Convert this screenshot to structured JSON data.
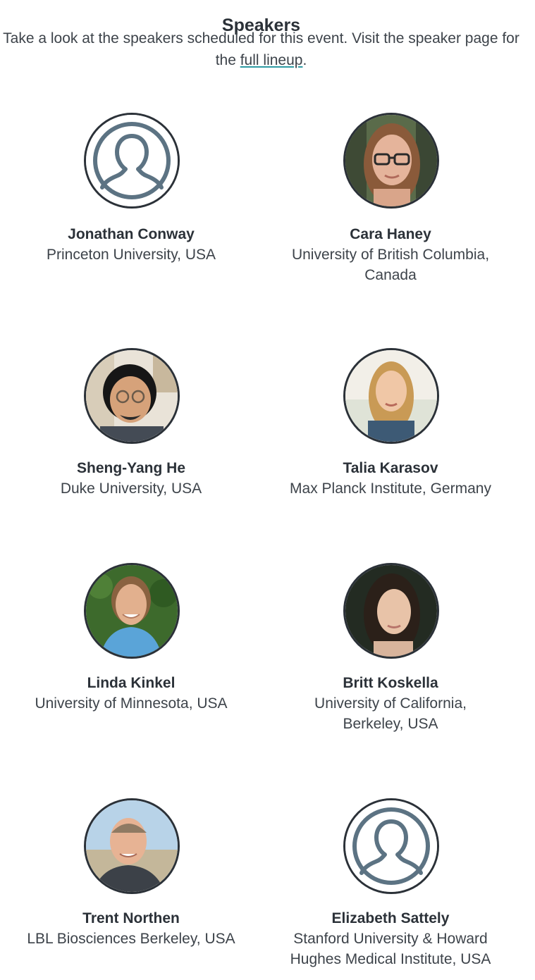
{
  "header": {
    "title": "Speakers",
    "intro_text": "Take a look at the speakers scheduled for this event. Visit the speaker page for the ",
    "link_label": "full lineup",
    "intro_end": "."
  },
  "speakers": [
    {
      "name": "Jonathan Conway",
      "affiliation": "Princeton University, USA",
      "photo": "placeholder-avatar-icon"
    },
    {
      "name": "Cara Haney",
      "affiliation": "University of British Columbia, Canada",
      "photo": "speaker-photo"
    },
    {
      "name": "Sheng-Yang He",
      "affiliation": "Duke University, USA",
      "photo": "speaker-photo"
    },
    {
      "name": "Talia Karasov",
      "affiliation": "Max Planck Institute, Germany",
      "photo": "speaker-photo"
    },
    {
      "name": "Linda Kinkel",
      "affiliation": "University of Minnesota, USA",
      "photo": "speaker-photo"
    },
    {
      "name": "Britt Koskella",
      "affiliation": "University of California, Berkeley, USA",
      "photo": "speaker-photo"
    },
    {
      "name": "Trent Northen",
      "affiliation": "LBL Biosciences Berkeley, USA",
      "photo": "speaker-photo"
    },
    {
      "name": "Elizabeth Sattely",
      "affiliation": "Stanford University & Howard Hughes Medical Institute, USA",
      "photo": "placeholder-avatar-icon"
    }
  ],
  "colors": {
    "text": "#333a42",
    "link_underline": "#2e9aa3",
    "avatar_placeholder": "#5c7383",
    "photo_border": "#2b3138"
  }
}
